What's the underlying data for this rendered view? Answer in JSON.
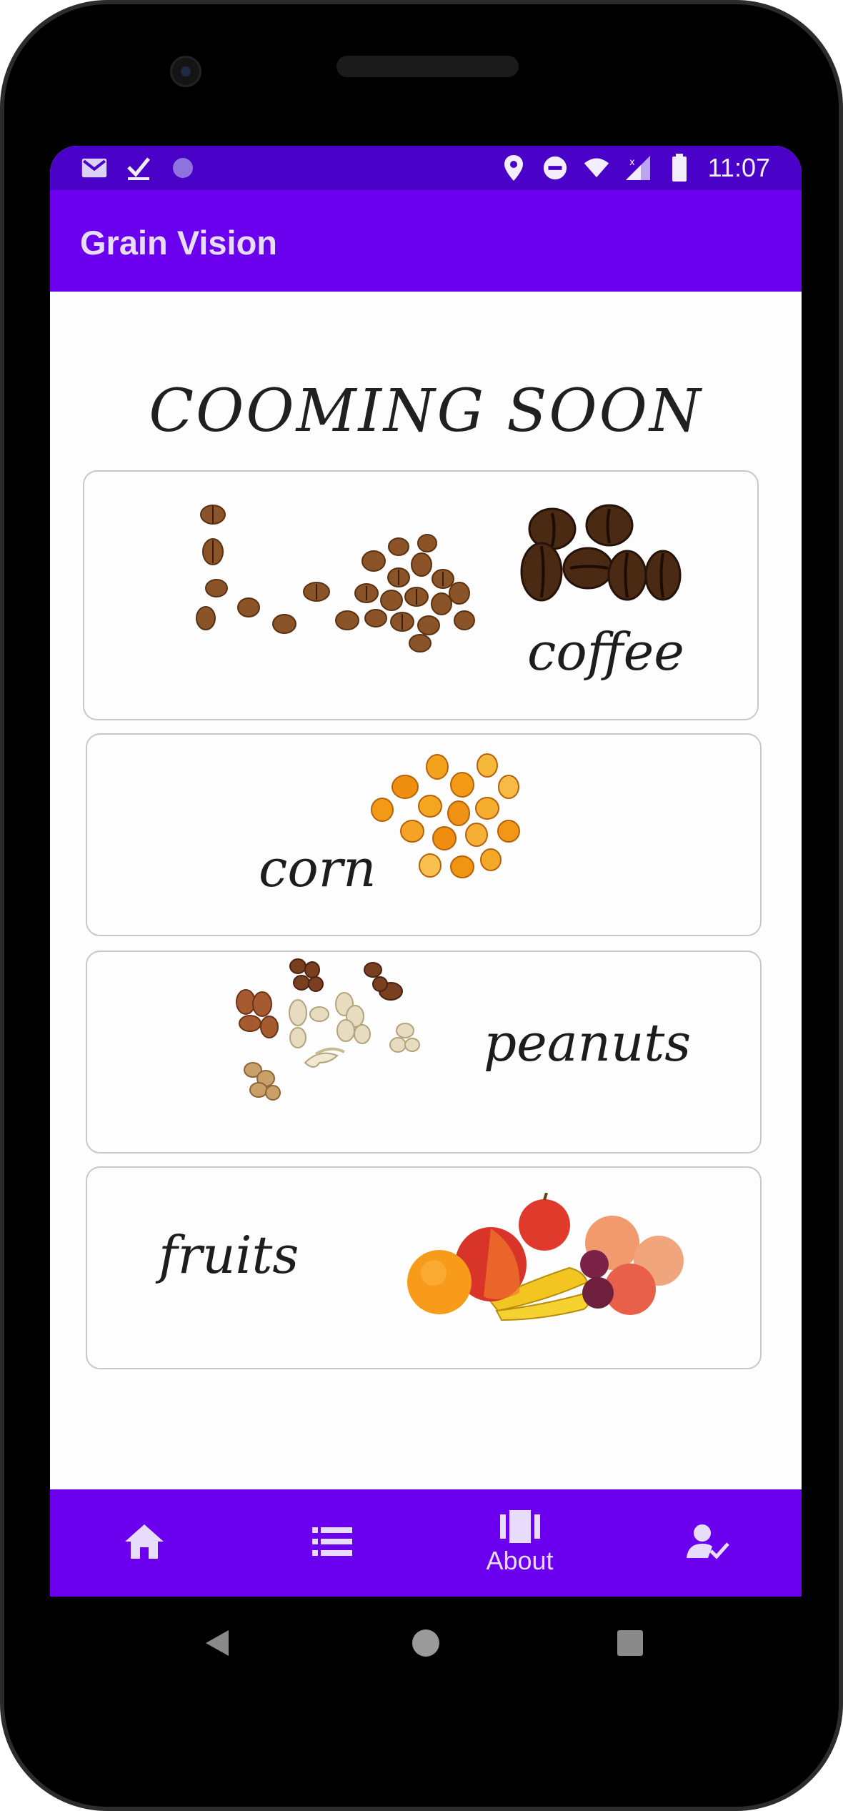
{
  "status_bar": {
    "time": "11:07",
    "left_icons": [
      "gmail-icon",
      "download-done-icon",
      "circle-icon"
    ],
    "right_icons": [
      "location-icon",
      "do-not-disturb-icon",
      "wifi-icon",
      "signal-icon",
      "battery-icon"
    ]
  },
  "app_bar": {
    "title": "Grain Vision"
  },
  "main": {
    "heading": "COOMING SOON",
    "cards": [
      {
        "label": "coffee",
        "icon": "coffee-beans-image"
      },
      {
        "label": "corn",
        "icon": "corn-kernels-image"
      },
      {
        "label": "peanuts",
        "icon": "nuts-image"
      },
      {
        "label": "fruits",
        "icon": "fruits-image"
      }
    ]
  },
  "bottom_nav": {
    "items": [
      {
        "icon": "home-icon",
        "label": ""
      },
      {
        "icon": "list-icon",
        "label": ""
      },
      {
        "icon": "carousel-icon",
        "label": "About"
      },
      {
        "icon": "user-check-icon",
        "label": ""
      }
    ]
  },
  "colors": {
    "status_bar": "#4a02c9",
    "primary": "#6a00ee",
    "nav_text": "#e8dcfb"
  }
}
